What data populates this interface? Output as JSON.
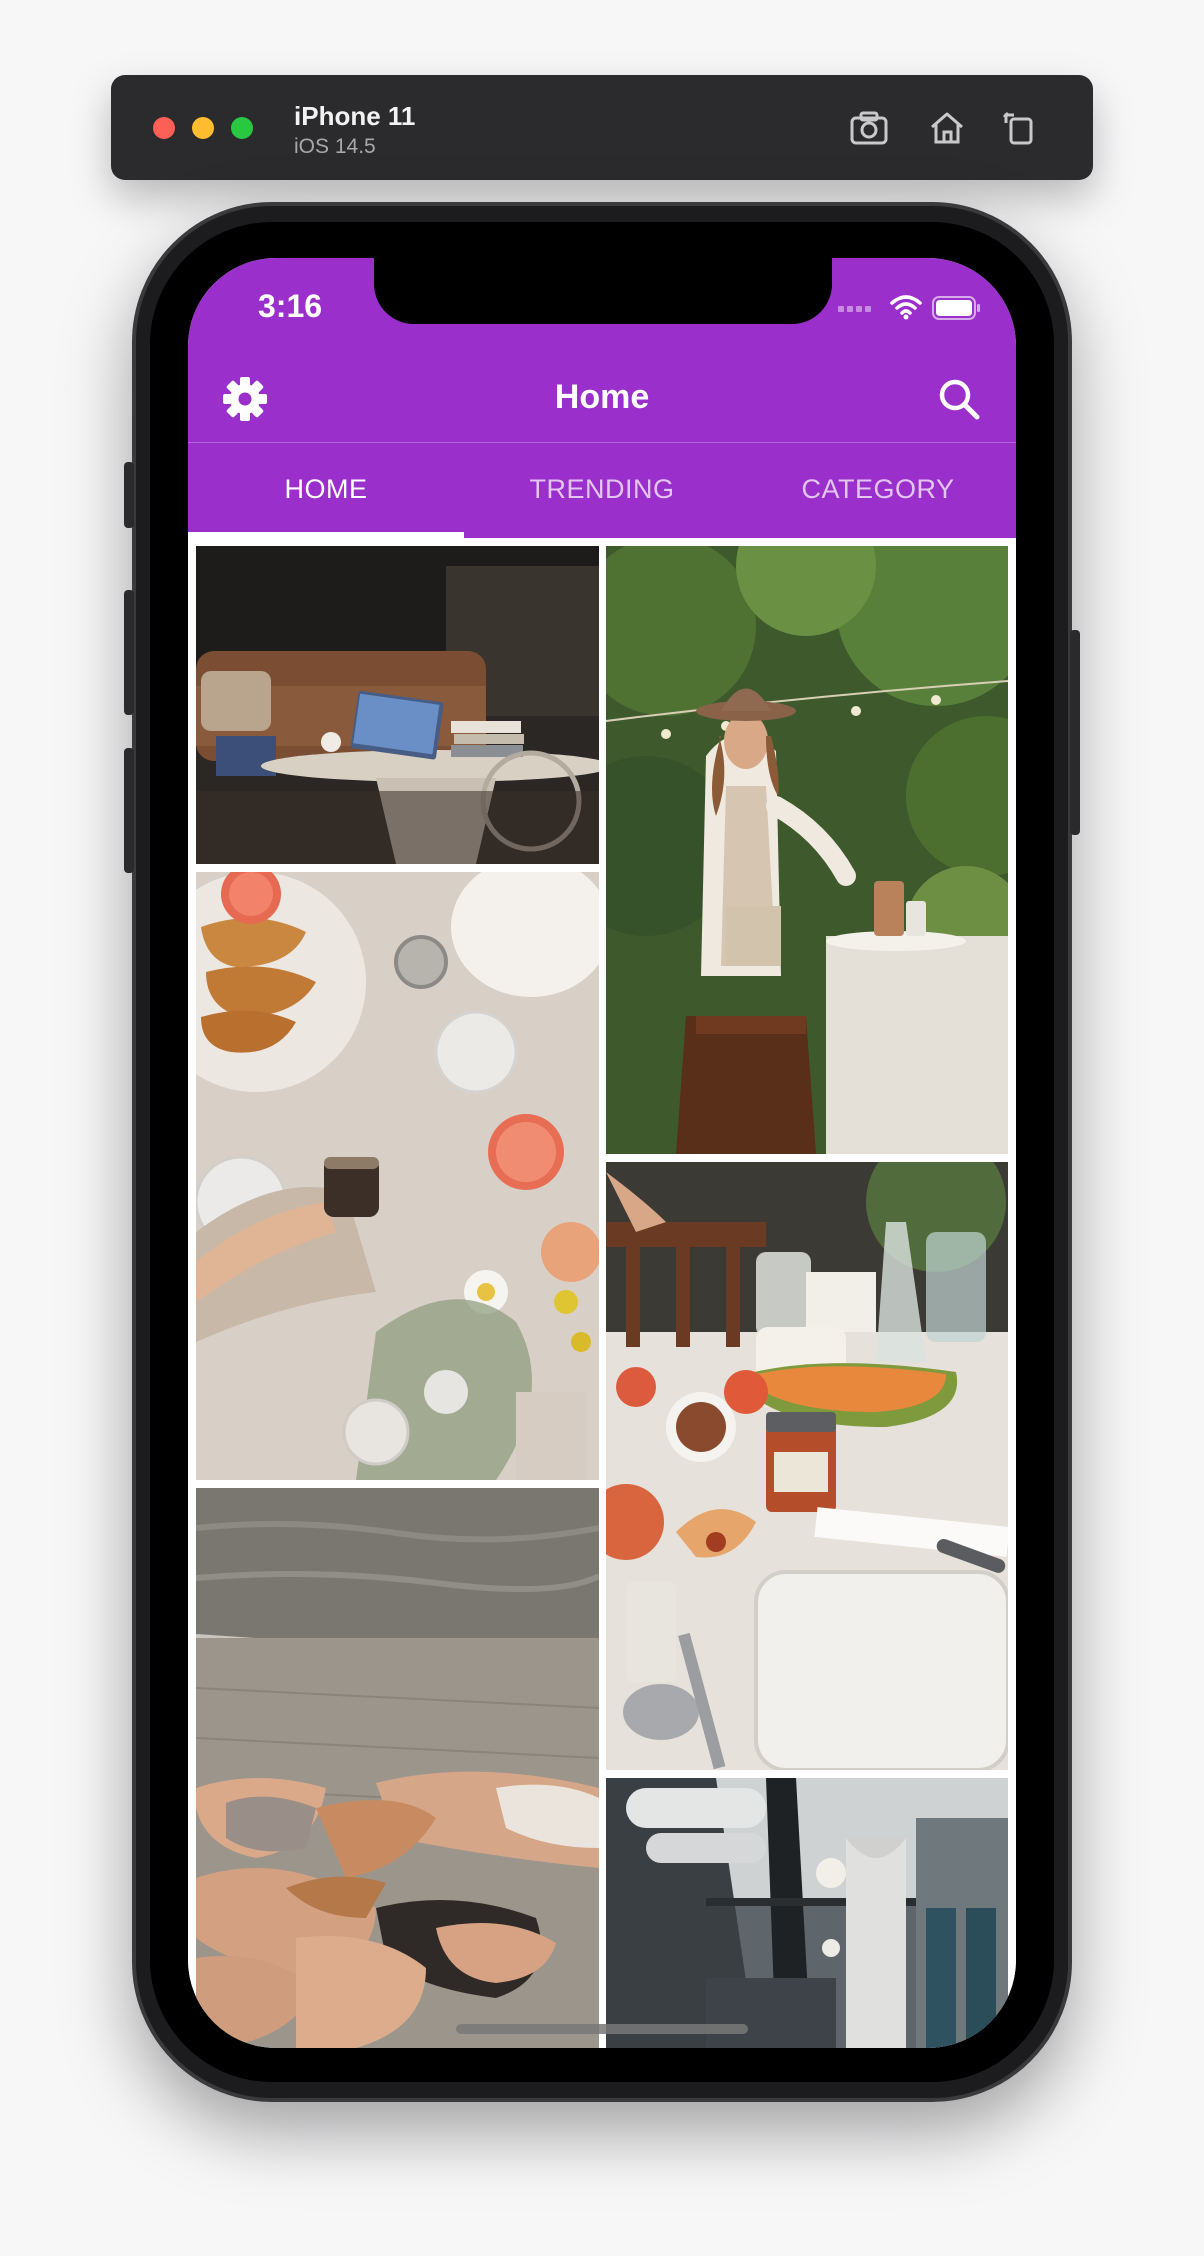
{
  "simulator": {
    "device_name": "iPhone 11",
    "os_version": "iOS 14.5"
  },
  "status_bar": {
    "time": "3:16"
  },
  "toolbar": {
    "title": "Home",
    "left_icon": "settings-gear-icon",
    "right_icon": "search-icon"
  },
  "tabs": [
    {
      "label": "HOME",
      "active": true
    },
    {
      "label": "TRENDING",
      "active": false
    },
    {
      "label": "CATEGORY",
      "active": false
    }
  ],
  "colors": {
    "primary": "#9a2fcb",
    "tab_indicator": "#ffffff"
  },
  "photos": [
    {
      "subject": "living room with laptop on coffee table"
    },
    {
      "subject": "woman in hat setting a garden table"
    },
    {
      "subject": "croissants and grapefruit brunch flat lay"
    },
    {
      "subject": "table with papaya, peaches and jam jar"
    },
    {
      "subject": "women lying on a lakeside dock"
    },
    {
      "subject": "industrial ceiling with pipes and lights"
    }
  ]
}
